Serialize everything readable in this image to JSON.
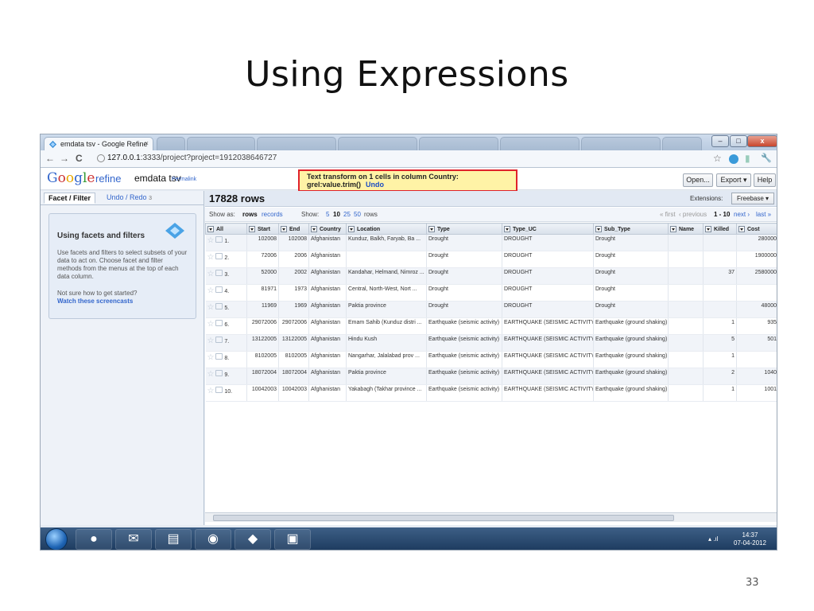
{
  "slide": {
    "title": "Using Expressions",
    "number": "33"
  },
  "browser": {
    "active_tab": "emdata tsv - Google Refine",
    "tab_close": "×",
    "url_host": "127.0.0.1",
    "url_rest": ":3333/project?project=1912038646727",
    "back_icon": "←",
    "forward_icon": "→",
    "reload_icon": "C",
    "window_controls": {
      "minimize": "–",
      "maximize": "□",
      "close": "x"
    },
    "toolbar_icons": {
      "star": "☆",
      "wrench": "🔧"
    }
  },
  "refine": {
    "logo": [
      "G",
      "o",
      "o",
      "g",
      "l",
      "e"
    ],
    "product": "refine",
    "project_name": "emdata tsv",
    "permalink": "Permalink",
    "notice_line1": "Text transform on 1 cells in column Country:",
    "notice_line2": "grel:value.trim()",
    "notice_undo": "Undo",
    "open_button": "Open...",
    "export_button": "Export ▾",
    "help_button": "Help"
  },
  "left_panel": {
    "tab_facet": "Facet / Filter",
    "tab_undo": "Undo / Redo",
    "tab_undo_count": "3",
    "help_title": "Using facets and filters",
    "help_text": "Use facets and filters to select subsets of your data to act on. Choose facet and filter methods from the menus at the top of each data column.",
    "help_start": "Not sure how to get started?",
    "help_link": "Watch these screencasts"
  },
  "main": {
    "rows_count": "17828 rows",
    "extensions_label": "Extensions:",
    "extensions_button": "Freebase ▾",
    "show_as": "Show as:",
    "rows_mode": "rows",
    "records_mode": "records",
    "show_label": "Show:",
    "page_sizes": [
      "5",
      "10",
      "25",
      "50"
    ],
    "rows_label": "rows",
    "pager_first": "« first",
    "pager_prev": "‹ previous",
    "pager_range": "1 - 10",
    "pager_next": "next ›",
    "pager_last": "last »"
  },
  "columns": [
    "All",
    "Start",
    "End",
    "Country",
    "Location",
    "Type",
    "Type_UC",
    "Sub_Type",
    "Name",
    "Killed",
    "Cost"
  ],
  "rows": [
    {
      "n": "1.",
      "start": "102008",
      "end": "102008",
      "country": "Afghanistan",
      "location": "Kunduz, Balkh, Faryab, Ba ...",
      "type": "Drought",
      "type_uc": "DROUGHT",
      "sub_type": "Drought",
      "name": "",
      "killed": "",
      "cost": "280000"
    },
    {
      "n": "2.",
      "start": "72006",
      "end": "2006",
      "country": "Afghanistan",
      "location": "",
      "type": "Drought",
      "type_uc": "DROUGHT",
      "sub_type": "Drought",
      "name": "",
      "killed": "",
      "cost": "1900000"
    },
    {
      "n": "3.",
      "start": "52000",
      "end": "2002",
      "country": "Afghanistan",
      "location": "Kandahar, Helmand, Nimroz ...",
      "type": "Drought",
      "type_uc": "DROUGHT",
      "sub_type": "Drought",
      "name": "",
      "killed": "37",
      "cost": "2580000"
    },
    {
      "n": "4.",
      "start": "81971",
      "end": "1973",
      "country": "Afghanistan",
      "location": "Central, North-West, Nort ...",
      "type": "Drought",
      "type_uc": "DROUGHT",
      "sub_type": "Drought",
      "name": "",
      "killed": "",
      "cost": ""
    },
    {
      "n": "5.",
      "start": "11969",
      "end": "1969",
      "country": "Afghanistan",
      "location": "Paktia province",
      "type": "Drought",
      "type_uc": "DROUGHT",
      "sub_type": "Drought",
      "name": "",
      "killed": "",
      "cost": "48000"
    },
    {
      "n": "6.",
      "start": "29072006",
      "end": "29072006",
      "country": "Afghanistan",
      "location": "Emam Sahib (Kunduz distri ...",
      "type": "Earthquake (seismic activity)",
      "type_uc": "EARTHQUAKE (SEISMIC ACTIVITY)",
      "sub_type": "Earthquake (ground shaking)",
      "name": "",
      "killed": "1",
      "cost": "935"
    },
    {
      "n": "7.",
      "start": "13122005",
      "end": "13122005",
      "country": "Afghanistan",
      "location": "Hindu Kush",
      "type": "Earthquake (seismic activity)",
      "type_uc": "EARTHQUAKE (SEISMIC ACTIVITY)",
      "sub_type": "Earthquake (ground shaking)",
      "name": "",
      "killed": "5",
      "cost": "501"
    },
    {
      "n": "8.",
      "start": "8102005",
      "end": "8102005",
      "country": "Afghanistan",
      "location": "Nangarhar, Jalalabad prov ...",
      "type": "Earthquake (seismic activity)",
      "type_uc": "EARTHQUAKE (SEISMIC ACTIVITY)",
      "sub_type": "Earthquake (ground shaking)",
      "name": "",
      "killed": "1",
      "cost": ""
    },
    {
      "n": "9.",
      "start": "18072004",
      "end": "18072004",
      "country": "Afghanistan",
      "location": "Paktia province",
      "type": "Earthquake (seismic activity)",
      "type_uc": "EARTHQUAKE (SEISMIC ACTIVITY)",
      "sub_type": "Earthquake (ground shaking)",
      "name": "",
      "killed": "2",
      "cost": "1040"
    },
    {
      "n": "10.",
      "start": "10042003",
      "end": "10042003",
      "country": "Afghanistan",
      "location": "Yakabagh (Takhar province ...",
      "type": "Earthquake (seismic activity)",
      "type_uc": "EARTHQUAKE (SEISMIC ACTIVITY)",
      "sub_type": "Earthquake (ground shaking)",
      "name": "",
      "killed": "1",
      "cost": "1001"
    }
  ],
  "taskbar": {
    "clock_time": "14:37",
    "clock_date": "07-04-2012"
  }
}
